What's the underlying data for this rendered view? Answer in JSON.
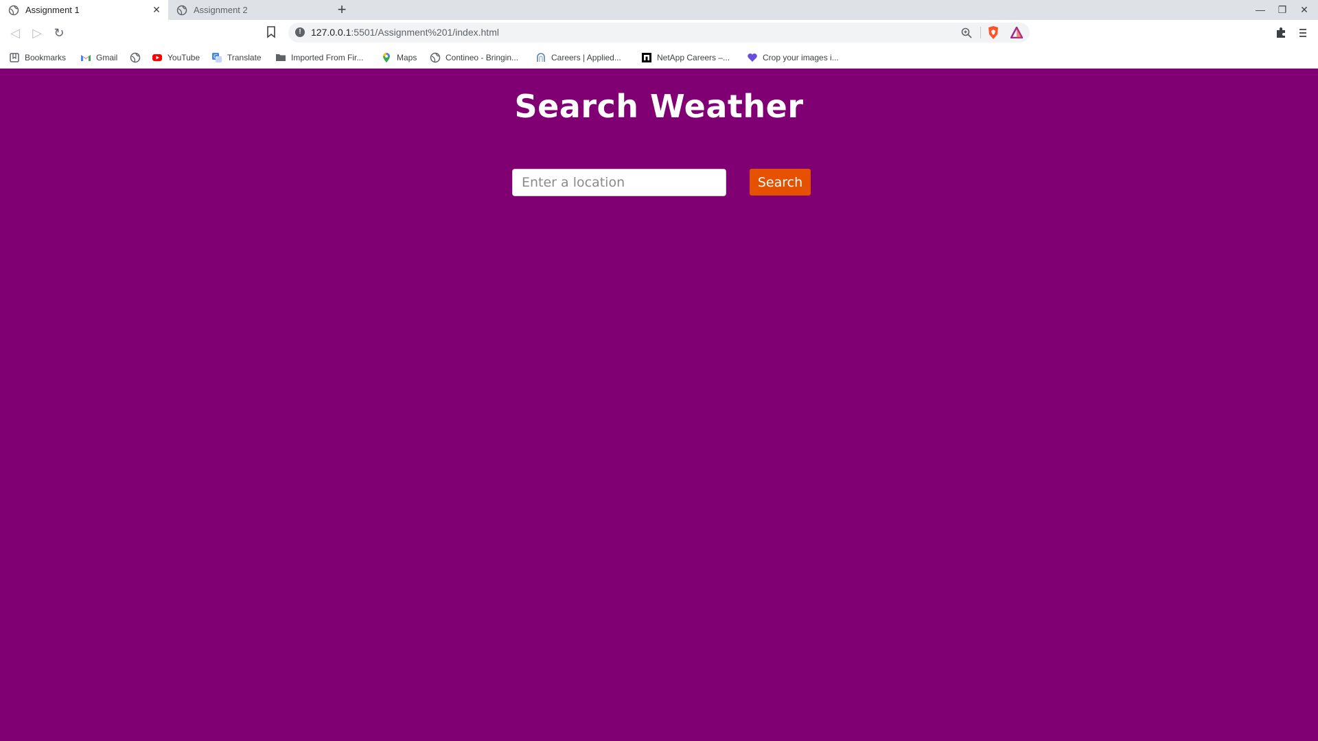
{
  "browser": {
    "tabs": [
      {
        "label": "Assignment 1",
        "active": true
      },
      {
        "label": "Assignment 2",
        "active": false
      }
    ],
    "url_host": "127.0.0.1",
    "url_path": ":5501/Assignment%201/index.html",
    "bookmarks": [
      {
        "label": "Bookmarks",
        "icon": "bookmarks-icon"
      },
      {
        "label": "Gmail",
        "icon": "gmail-icon"
      },
      {
        "label": "",
        "icon": "globe-icon"
      },
      {
        "label": "YouTube",
        "icon": "youtube-icon"
      },
      {
        "label": "Translate",
        "icon": "translate-icon"
      },
      {
        "label": "Imported From Fir...",
        "icon": "folder-icon"
      },
      {
        "label": "Maps",
        "icon": "maps-icon"
      },
      {
        "label": "Contineo - Bringin...",
        "icon": "globe-icon"
      },
      {
        "label": "Careers | Applied...",
        "icon": "careers-icon"
      },
      {
        "label": "NetApp Careers –...",
        "icon": "netapp-icon"
      },
      {
        "label": "Crop your images i...",
        "icon": "heart-icon"
      }
    ]
  },
  "page": {
    "title": "Search Weather",
    "search_placeholder": "Enter a location",
    "search_value": "",
    "search_button": "Search"
  },
  "colors": {
    "background": "#800074",
    "button": "#e65100",
    "title": "#ffffff"
  }
}
